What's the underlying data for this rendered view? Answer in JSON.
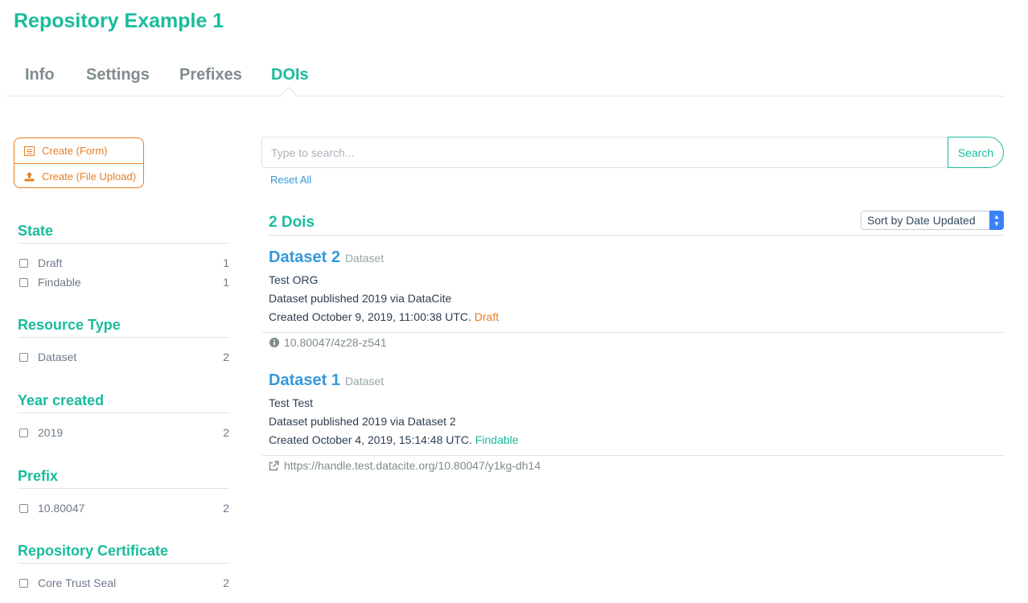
{
  "page": {
    "title": "Repository Example 1"
  },
  "tabs": [
    {
      "label": "Info"
    },
    {
      "label": "Settings"
    },
    {
      "label": "Prefixes"
    },
    {
      "label": "DOIs",
      "active": true
    }
  ],
  "create": {
    "form_label": "Create (Form)",
    "upload_label": "Create (File Upload)"
  },
  "facets": {
    "state": {
      "title": "State",
      "items": [
        {
          "label": "Draft",
          "count": "1"
        },
        {
          "label": "Findable",
          "count": "1"
        }
      ]
    },
    "resource_type": {
      "title": "Resource Type",
      "items": [
        {
          "label": "Dataset",
          "count": "2"
        }
      ]
    },
    "year_created": {
      "title": "Year created",
      "items": [
        {
          "label": "2019",
          "count": "2"
        }
      ]
    },
    "prefix": {
      "title": "Prefix",
      "items": [
        {
          "label": "10.80047",
          "count": "2"
        }
      ]
    },
    "repository_certificate": {
      "title": "Repository Certificate",
      "items": [
        {
          "label": "Core Trust Seal",
          "count": "2"
        }
      ]
    }
  },
  "search": {
    "placeholder": "Type to search...",
    "button_label": "Search",
    "reset_label": "Reset All"
  },
  "results": {
    "count_label": "2 Dois",
    "sort_label": "Sort by Date Updated",
    "items": [
      {
        "title": "Dataset 2",
        "type": "Dataset",
        "creator": "Test ORG",
        "published": "Dataset published 2019 via DataCite",
        "created": "Created October 9, 2019, 11:00:38 UTC.",
        "state": "Draft",
        "footer": "10.80047/4z28-z541",
        "footer_icon": "info-circle-icon"
      },
      {
        "title": "Dataset 1",
        "type": "Dataset",
        "creator": "Test Test",
        "published": "Dataset published 2019 via Dataset 2",
        "created": "Created October 4, 2019, 15:14:48 UTC.",
        "state": "Findable",
        "footer": "https://handle.test.datacite.org/10.80047/y1kg-dh14",
        "footer_icon": "external-link-icon"
      }
    ]
  },
  "colors": {
    "accent": "#1abc9c",
    "link": "#3498db",
    "orange": "#e67e22"
  }
}
